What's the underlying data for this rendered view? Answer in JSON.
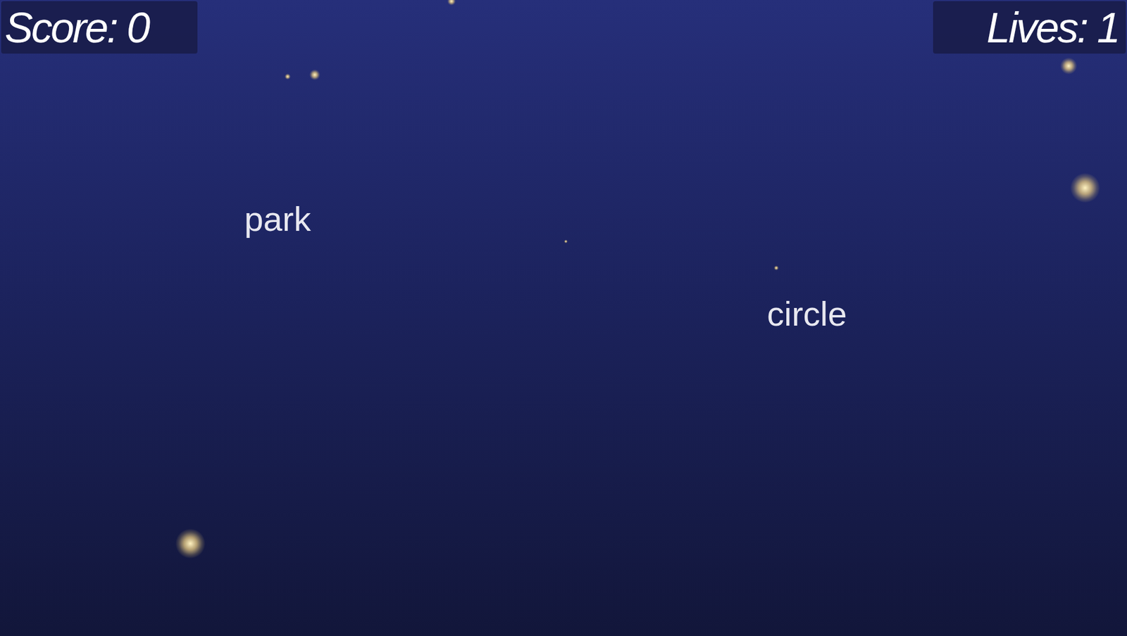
{
  "hud": {
    "score": "Score: 0",
    "lives": "Lives: 1"
  },
  "words": [
    "park",
    "circle"
  ]
}
